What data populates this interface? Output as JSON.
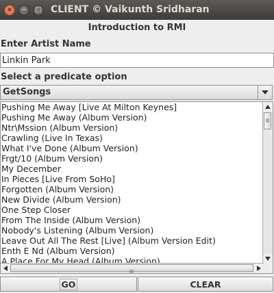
{
  "window": {
    "title": "CLIENT © Vaikunth Sridharan",
    "close_glyph": "×",
    "minimize_glyph": "−",
    "maximize_glyph": "□"
  },
  "heading": "Introduction to RMI",
  "artist": {
    "label": "Enter Artist Name",
    "value": "Linkin Park"
  },
  "predicate": {
    "label": "Select a predicate option",
    "selected": "GetSongs"
  },
  "results": {
    "items": [
      "Pushing Me Away [Live At Milton Keynes]",
      "Pushing Me Away (Album Version)",
      "Ntr\\Mssion (Album Version)",
      "Crawling (Live In Texas)",
      "What I've Done (Album Version)",
      "Frgt/10 (Album Version)",
      "My December",
      "In Pieces [Live From SoHo]",
      "Forgotten (Album Version)",
      "New Divide (Album Version)",
      "One Step Closer",
      "From The Inside (Album Version)",
      "Nobody's Listening (Album Version)",
      "Leave Out All The Rest [Live] (Album Version Edit)",
      "Enth E Nd (Album Version)",
      "A Place For My Head (Album Version)"
    ]
  },
  "buttons": {
    "go": "GO",
    "clear": "CLEAR"
  }
}
